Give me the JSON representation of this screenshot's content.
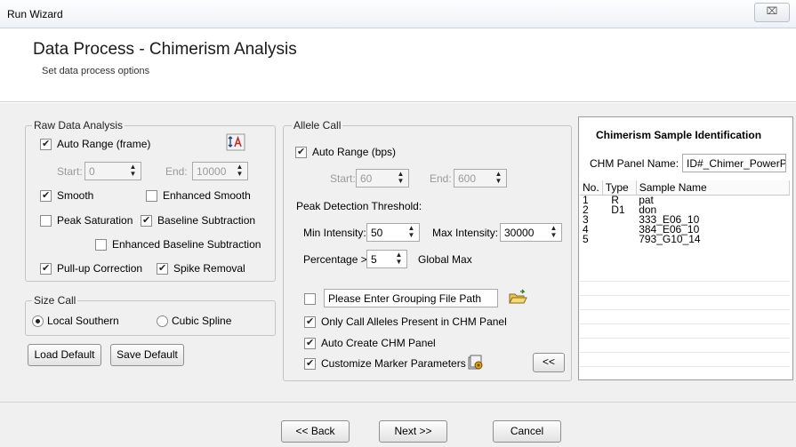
{
  "window": {
    "title": "Run Wizard",
    "close_glyph": "⌧"
  },
  "header": {
    "title": "Data Process - Chimerism Analysis",
    "subtitle": "Set data process options"
  },
  "raw_data": {
    "legend": "Raw Data Analysis",
    "auto_range_label": "Auto Range (frame)",
    "start_label": "Start:",
    "start_value": "0",
    "end_label": "End:",
    "end_value": "10000",
    "smooth_label": "Smooth",
    "enhanced_smooth_label": "Enhanced Smooth",
    "peak_saturation_label": "Peak Saturation",
    "baseline_subtraction_label": "Baseline Subtraction",
    "enhanced_baseline_label": "Enhanced Baseline Subtraction",
    "pullup_label": "Pull-up Correction",
    "spike_label": "Spike Removal"
  },
  "size_call": {
    "legend": "Size Call",
    "local_southern_label": "Local Southern",
    "cubic_spline_label": "Cubic Spline"
  },
  "defaults": {
    "load_label": "Load Default",
    "save_label": "Save Default"
  },
  "allele_call": {
    "legend": "Allele Call",
    "auto_range_label": "Auto Range (bps)",
    "start_label": "Start:",
    "start_value": "60",
    "end_label": "End:",
    "end_value": "600",
    "threshold_label": "Peak Detection Threshold:",
    "min_label": "Min Intensity:",
    "min_value": "50",
    "max_label": "Max Intensity:",
    "max_value": "30000",
    "pct_label": "Percentage >",
    "pct_value": "5",
    "global_max_label": "Global Max",
    "grouping_placeholder": "Please Enter Grouping File Path",
    "only_call_label": "Only Call Alleles Present in CHM Panel",
    "auto_create_label": "Auto Create CHM Panel",
    "customize_label": "Customize Marker Parameters",
    "collapse_label": "<<"
  },
  "chimerism": {
    "title": "Chimerism Sample Identification",
    "panel_name_label": "CHM Panel Name:",
    "panel_name_value": "ID#_Chimer_PowerP",
    "columns": [
      "No.",
      "Type",
      "Sample Name"
    ],
    "rows": [
      {
        "no": "1",
        "type": "R",
        "name": "pat"
      },
      {
        "no": "2",
        "type": "D1",
        "name": "don"
      },
      {
        "no": "3",
        "type": "",
        "name": "333_E06_10"
      },
      {
        "no": "4",
        "type": "",
        "name": "384_E06_10"
      },
      {
        "no": "5",
        "type": "",
        "name": "793_G10_14"
      }
    ]
  },
  "footer": {
    "back_label": "<< Back",
    "next_label": "Next >>",
    "cancel_label": "Cancel"
  },
  "colors": {
    "titlebar": "#eef2f7",
    "body": "#f0f0f0",
    "border": "#c4c4c4"
  }
}
